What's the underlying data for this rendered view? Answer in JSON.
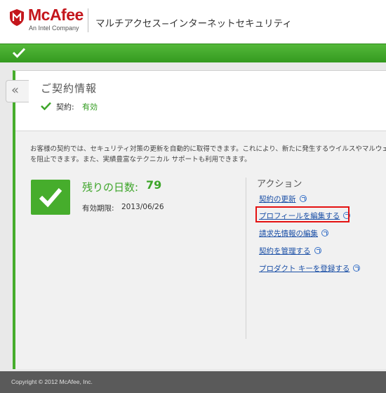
{
  "header": {
    "logo_text": "McAfee",
    "logo_sub": "An Intel Company",
    "product_title": "マルチアクセス−インターネットセキュリティ"
  },
  "contract": {
    "title": "ご契約情報",
    "label": "契約:",
    "value": "有効"
  },
  "description": "お客様の契約では、セキュリティ対策の更新を自動的に取得できます。これにより、新たに発生するウイルスやマルウェ\nを阻止できます。また、実績豊富なテクニカル サポートも利用できます。",
  "status": {
    "days_label": "残りの日数:",
    "days_value": "79",
    "expiry_label": "有効期限:",
    "expiry_value": "2013/06/26"
  },
  "actions": {
    "heading": "アクション",
    "links": [
      "契約の更新",
      "プロフィールを編集する",
      "請求先情報の編集",
      "契約を管理する",
      "プロダクト キーを登録する"
    ]
  },
  "footer": {
    "copyright": "Copyright © 2012 McAfee, Inc."
  },
  "colors": {
    "brand_red": "#c4161c",
    "accent_green": "#46ad2c",
    "link_blue": "#1a4fa6",
    "highlight_red": "#e41111"
  },
  "icons": {
    "back": "double-chevron-left-icon",
    "status": "check-icon",
    "external": "external-link-icon"
  }
}
